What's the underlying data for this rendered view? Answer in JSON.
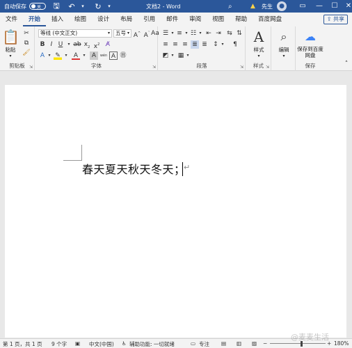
{
  "titlebar": {
    "autosave_label": "自动保存",
    "autosave_state": "关",
    "doc_title": "文档2 - Word",
    "user_name": "先生",
    "save_icon": "save-icon",
    "undo_icon": "undo-icon",
    "redo_icon": "redo-icon"
  },
  "tabs": [
    "文件",
    "开始",
    "插入",
    "绘图",
    "设计",
    "布局",
    "引用",
    "邮件",
    "审阅",
    "视图",
    "帮助",
    "百度网盘"
  ],
  "active_tab": "开始",
  "share_label": "共享",
  "ribbon": {
    "clipboard": {
      "paste_label": "粘贴",
      "group_label": "剪贴板"
    },
    "font": {
      "font_name": "等线 (中文正文)",
      "font_size": "五号",
      "group_label": "字体",
      "aa_label": "wén"
    },
    "paragraph": {
      "group_label": "段落"
    },
    "styles": {
      "styles_label": "样式",
      "group_label": "样式"
    },
    "editing": {
      "editing_label": "编辑"
    },
    "save": {
      "save_label": "保存到百度网盘",
      "group_label": "保存"
    }
  },
  "document": {
    "text": "春天夏天秋天冬天；"
  },
  "statusbar": {
    "page": "第 1 页，共 1 页",
    "words": "9 个字",
    "language": "中文(中国)",
    "accessibility": "辅助功能: 一切就绪",
    "focus": "专注",
    "zoom": "180%"
  },
  "watermark": "@麦麦生活",
  "colors": {
    "accent": "#2b579a",
    "titlebar": "#2b579a"
  }
}
